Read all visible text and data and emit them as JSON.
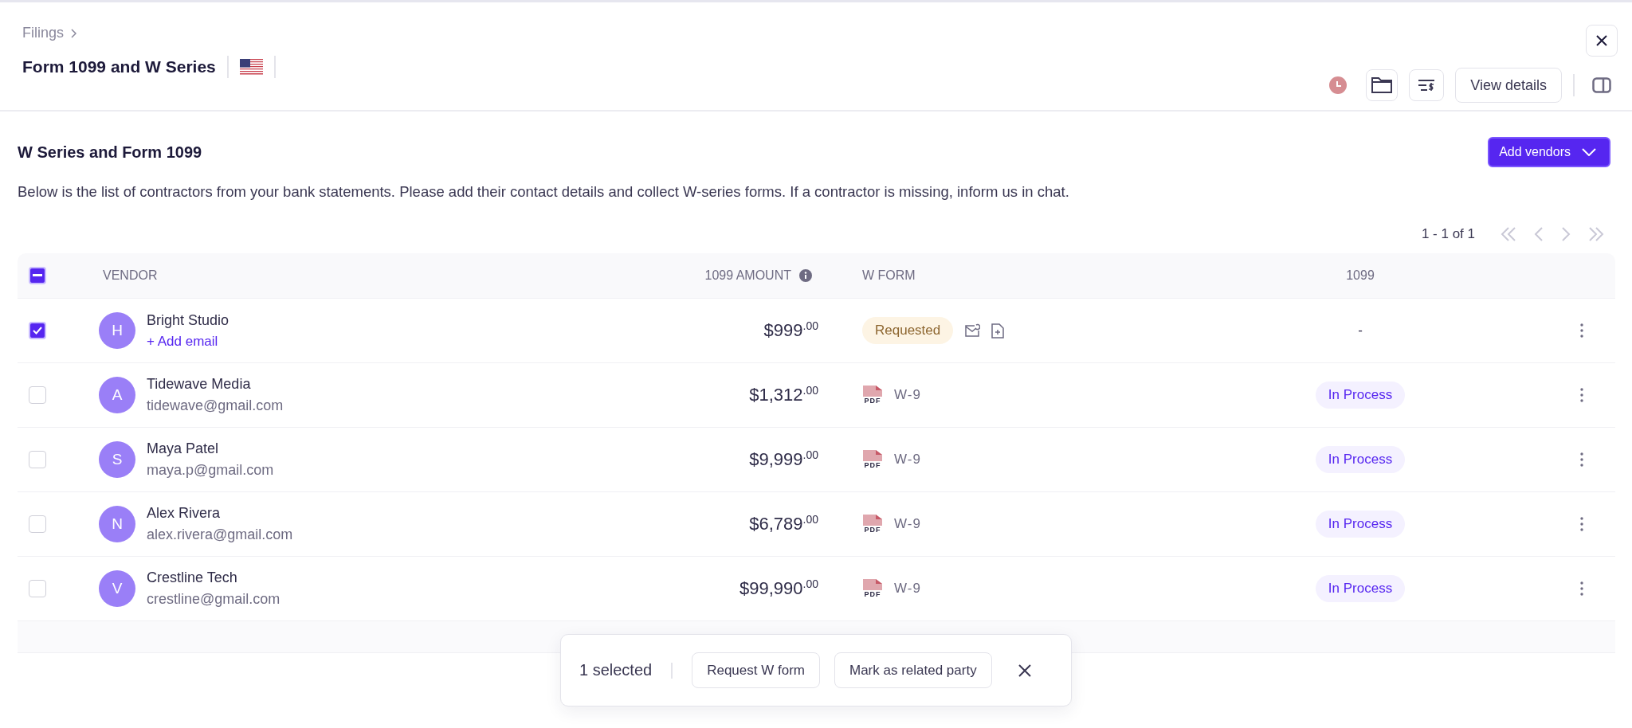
{
  "breadcrumb": "Filings",
  "title": "Form 1099 and W Series",
  "toolbar": {
    "view_details": "View details"
  },
  "section": {
    "title": "W Series and Form 1099",
    "add_button": "Add vendors",
    "description": "Below is the list of contractors from your bank statements. Please add their contact details and collect W-series forms. If a contractor is missing, inform us in chat."
  },
  "pagination": "1 - 1 of 1",
  "table": {
    "select_all": {
      "indeterminate": true
    },
    "columns": [
      "VENDOR",
      "1099 AMOUNT",
      "W FORM",
      "1099"
    ],
    "rows": [
      {
        "selected": true,
        "avatar": "H",
        "name": "Bright Studio",
        "contact": {
          "kind": "add",
          "text": "+ Add email"
        },
        "amount": "$999",
        "cents": ".00",
        "w_form": {
          "kind": "status",
          "text": "Requested"
        },
        "status_1099": {
          "kind": "empty",
          "text": "-"
        }
      },
      {
        "selected": false,
        "avatar": "A",
        "name": "Tidewave Media",
        "contact": {
          "kind": "email",
          "text": "tidewave@gmail.com"
        },
        "amount": "$1,312",
        "cents": ".00",
        "w_form": {
          "kind": "file",
          "badge": "PDF",
          "text": "W-9"
        },
        "status_1099": {
          "kind": "pill",
          "text": "In Process"
        }
      },
      {
        "selected": false,
        "avatar": "S",
        "name": "Maya Patel",
        "contact": {
          "kind": "email",
          "text": "maya.p@gmail.com"
        },
        "amount": "$9,999",
        "cents": ".00",
        "w_form": {
          "kind": "file",
          "badge": "PDF",
          "text": "W-9"
        },
        "status_1099": {
          "kind": "pill",
          "text": "In Process"
        }
      },
      {
        "selected": false,
        "avatar": "N",
        "name": "Alex Rivera",
        "contact": {
          "kind": "email",
          "text": "alex.rivera@gmail.com"
        },
        "amount": "$6,789",
        "cents": ".00",
        "w_form": {
          "kind": "file",
          "badge": "PDF",
          "text": "W-9"
        },
        "status_1099": {
          "kind": "pill",
          "text": "In Process"
        }
      },
      {
        "selected": false,
        "avatar": "V",
        "name": "Crestline Tech",
        "contact": {
          "kind": "email",
          "text": "crestline@gmail.com"
        },
        "amount": "$99,990",
        "cents": ".00",
        "w_form": {
          "kind": "file",
          "badge": "PDF",
          "text": "W-9"
        },
        "status_1099": {
          "kind": "pill",
          "text": "In Process"
        }
      }
    ]
  },
  "selection_bar": {
    "count": "1 selected",
    "actions": [
      "Request W form",
      "Mark as related party"
    ]
  }
}
